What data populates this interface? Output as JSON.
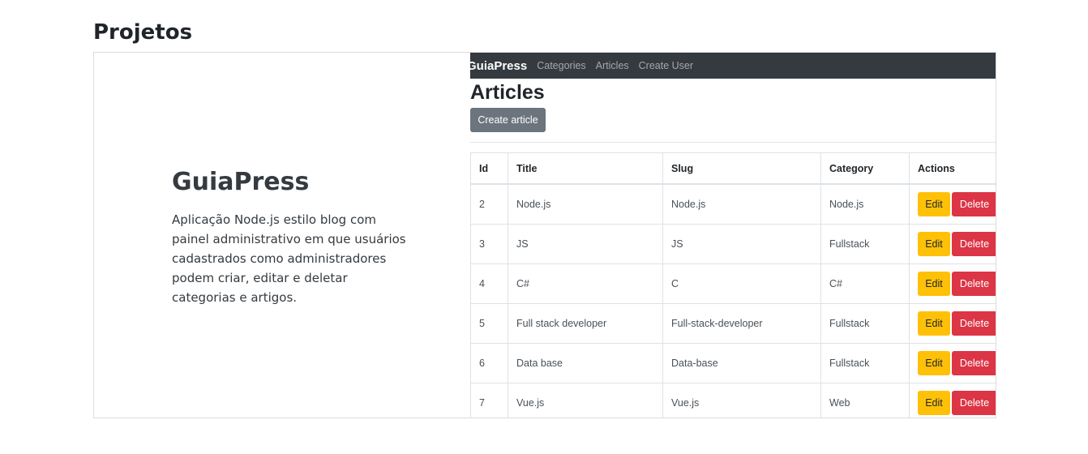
{
  "section": {
    "title": "Projetos"
  },
  "project": {
    "title": "GuiaPress",
    "description": "Aplicação Node.js estilo blog com painel administrativo em que usuários cadastrados como administradores podem criar, editar e deletar categorias e artigos."
  },
  "screenshot": {
    "navbar": {
      "brand": "GuiaPress",
      "links": [
        "Categories",
        "Articles",
        "Create User"
      ]
    },
    "heading": "Articles",
    "create_button": "Create article",
    "table": {
      "headers": [
        "Id",
        "Title",
        "Slug",
        "Category",
        "Actions"
      ],
      "edit_label": "Edit",
      "delete_label": "Delete",
      "rows": [
        {
          "id": "2",
          "title": "Node.js",
          "slug": "Node.js",
          "category": "Node.js"
        },
        {
          "id": "3",
          "title": "JS",
          "slug": "JS",
          "category": "Fullstack"
        },
        {
          "id": "4",
          "title": "C#",
          "slug": "C",
          "category": "C#"
        },
        {
          "id": "5",
          "title": "Full stack developer",
          "slug": "Full-stack-developer",
          "category": "Fullstack"
        },
        {
          "id": "6",
          "title": "Data base",
          "slug": "Data-base",
          "category": "Fullstack"
        },
        {
          "id": "7",
          "title": "Vue.js",
          "slug": "Vue.js",
          "category": "Web"
        }
      ]
    }
  },
  "colors": {
    "navbar_bg": "#343a40",
    "create_button": "#6c757d",
    "edit_button": "#ffc107",
    "delete_button": "#dc3545"
  }
}
